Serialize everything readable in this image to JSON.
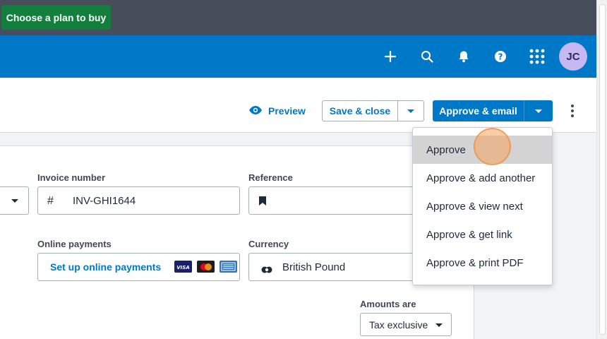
{
  "trial_bar": {
    "cta_label": "Choose a plan to buy"
  },
  "header": {
    "icons": [
      "plus-icon",
      "search-icon",
      "bell-icon",
      "help-icon",
      "apps-grid-icon"
    ],
    "avatar_initials": "JC"
  },
  "toolbar": {
    "preview_label": "Preview",
    "save_close_label": "Save & close",
    "approve_email_label": "Approve & email"
  },
  "form": {
    "invoice_number_label": "Invoice number",
    "invoice_number_value": "INV-GHI1644",
    "invoice_number_prefix": "#",
    "reference_label": "Reference",
    "online_payments_label": "Online payments",
    "online_payments_link": "Set up online payments",
    "payment_cards": [
      "visa",
      "mastercard",
      "amex"
    ],
    "currency_label": "Currency",
    "currency_value": "British Pound",
    "amounts_are_label": "Amounts are",
    "amounts_are_value": "Tax exclusive"
  },
  "approve_menu": {
    "items": [
      "Approve",
      "Approve & add another",
      "Approve & view next",
      "Approve & get link",
      "Approve & print PDF"
    ],
    "active_index": 0
  },
  "colors": {
    "brand_blue": "#0078c8",
    "trial_green": "#12803c",
    "header_dark": "#474d5a"
  }
}
